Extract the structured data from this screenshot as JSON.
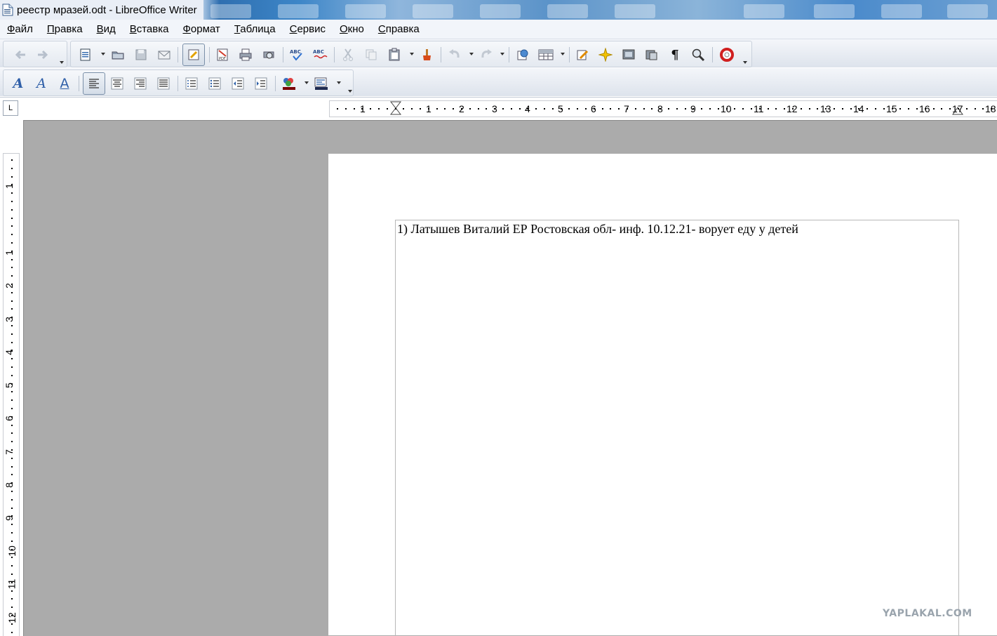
{
  "window": {
    "title": "реестр мразей.odt - LibreOffice Writer"
  },
  "menu": [
    {
      "label": "Файл",
      "key": "Ф",
      "rest": "айл"
    },
    {
      "label": "Правка",
      "key": "П",
      "rest": "равка"
    },
    {
      "label": "Вид",
      "key": "В",
      "rest": "ид"
    },
    {
      "label": "Вставка",
      "key": "В",
      "rest": "ставка"
    },
    {
      "label": "Формат",
      "key": "Ф",
      "rest": "ормат"
    },
    {
      "label": "Таблица",
      "key": "Т",
      "rest": "аблица"
    },
    {
      "label": "Сервис",
      "key": "С",
      "rest": "ервис"
    },
    {
      "label": "Окно",
      "key": "О",
      "rest": "кно"
    },
    {
      "label": "Справка",
      "key": "С",
      "rest": "правка"
    }
  ],
  "toolbar_standard": [
    "back-icon",
    "forward-icon",
    "new-document-icon",
    "open-icon",
    "save-icon",
    "email-icon",
    "edit-mode-icon",
    "export-pdf-icon",
    "print-icon",
    "print-preview-icon",
    "spellcheck-icon",
    "autospellcheck-icon",
    "cut-icon",
    "copy-icon",
    "paste-icon",
    "format-paintbrush-icon",
    "undo-icon",
    "redo-icon",
    "navigator-icon",
    "table-icon",
    "draw-functions-icon",
    "navigator-star-icon",
    "gallery-icon",
    "data-sources-icon",
    "pilcrow-icon",
    "zoom-icon",
    "help-icon"
  ],
  "toolbar_formatting": [
    "fontwork-style-icon",
    "italic-a-icon",
    "outline-a-icon",
    "align-left-icon",
    "align-center-icon",
    "align-right-icon",
    "justify-icon",
    "numbered-list-icon",
    "bullet-list-icon",
    "decrease-indent-icon",
    "increase-indent-icon",
    "highlight-color-icon",
    "paragraph-background-icon"
  ],
  "ruler": {
    "corner": "L",
    "h_numbers": [
      "1",
      "1",
      "2",
      "3",
      "4",
      "5",
      "6",
      "7",
      "8",
      "9",
      "10",
      "11",
      "12",
      "13",
      "14",
      "15",
      "16",
      "17",
      "18"
    ],
    "v_numbers": [
      "1",
      "1",
      "2",
      "3",
      "4",
      "5",
      "6",
      "7",
      "8",
      "9",
      "10",
      "11",
      "12"
    ]
  },
  "document": {
    "text": "1) Латышев Виталий  ЕР Ростовская обл- инф. 10.12.21- ворует еду у детей"
  },
  "watermark": "YAPLAKAL.COM",
  "colors": {
    "canvas": "#ababab",
    "toolbar": "#e4e9f0",
    "accent": "#3d86c8"
  }
}
